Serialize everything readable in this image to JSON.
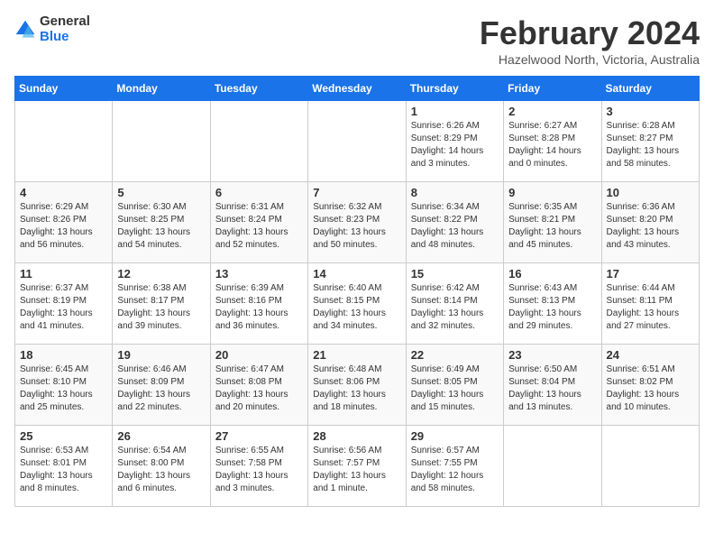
{
  "header": {
    "logo_general": "General",
    "logo_blue": "Blue",
    "month_title": "February 2024",
    "subtitle": "Hazelwood North, Victoria, Australia"
  },
  "days_of_week": [
    "Sunday",
    "Monday",
    "Tuesday",
    "Wednesday",
    "Thursday",
    "Friday",
    "Saturday"
  ],
  "weeks": [
    [
      {
        "day": "",
        "info": ""
      },
      {
        "day": "",
        "info": ""
      },
      {
        "day": "",
        "info": ""
      },
      {
        "day": "",
        "info": ""
      },
      {
        "day": "1",
        "info": "Sunrise: 6:26 AM\nSunset: 8:29 PM\nDaylight: 14 hours\nand 3 minutes."
      },
      {
        "day": "2",
        "info": "Sunrise: 6:27 AM\nSunset: 8:28 PM\nDaylight: 14 hours\nand 0 minutes."
      },
      {
        "day": "3",
        "info": "Sunrise: 6:28 AM\nSunset: 8:27 PM\nDaylight: 13 hours\nand 58 minutes."
      }
    ],
    [
      {
        "day": "4",
        "info": "Sunrise: 6:29 AM\nSunset: 8:26 PM\nDaylight: 13 hours\nand 56 minutes."
      },
      {
        "day": "5",
        "info": "Sunrise: 6:30 AM\nSunset: 8:25 PM\nDaylight: 13 hours\nand 54 minutes."
      },
      {
        "day": "6",
        "info": "Sunrise: 6:31 AM\nSunset: 8:24 PM\nDaylight: 13 hours\nand 52 minutes."
      },
      {
        "day": "7",
        "info": "Sunrise: 6:32 AM\nSunset: 8:23 PM\nDaylight: 13 hours\nand 50 minutes."
      },
      {
        "day": "8",
        "info": "Sunrise: 6:34 AM\nSunset: 8:22 PM\nDaylight: 13 hours\nand 48 minutes."
      },
      {
        "day": "9",
        "info": "Sunrise: 6:35 AM\nSunset: 8:21 PM\nDaylight: 13 hours\nand 45 minutes."
      },
      {
        "day": "10",
        "info": "Sunrise: 6:36 AM\nSunset: 8:20 PM\nDaylight: 13 hours\nand 43 minutes."
      }
    ],
    [
      {
        "day": "11",
        "info": "Sunrise: 6:37 AM\nSunset: 8:19 PM\nDaylight: 13 hours\nand 41 minutes."
      },
      {
        "day": "12",
        "info": "Sunrise: 6:38 AM\nSunset: 8:17 PM\nDaylight: 13 hours\nand 39 minutes."
      },
      {
        "day": "13",
        "info": "Sunrise: 6:39 AM\nSunset: 8:16 PM\nDaylight: 13 hours\nand 36 minutes."
      },
      {
        "day": "14",
        "info": "Sunrise: 6:40 AM\nSunset: 8:15 PM\nDaylight: 13 hours\nand 34 minutes."
      },
      {
        "day": "15",
        "info": "Sunrise: 6:42 AM\nSunset: 8:14 PM\nDaylight: 13 hours\nand 32 minutes."
      },
      {
        "day": "16",
        "info": "Sunrise: 6:43 AM\nSunset: 8:13 PM\nDaylight: 13 hours\nand 29 minutes."
      },
      {
        "day": "17",
        "info": "Sunrise: 6:44 AM\nSunset: 8:11 PM\nDaylight: 13 hours\nand 27 minutes."
      }
    ],
    [
      {
        "day": "18",
        "info": "Sunrise: 6:45 AM\nSunset: 8:10 PM\nDaylight: 13 hours\nand 25 minutes."
      },
      {
        "day": "19",
        "info": "Sunrise: 6:46 AM\nSunset: 8:09 PM\nDaylight: 13 hours\nand 22 minutes."
      },
      {
        "day": "20",
        "info": "Sunrise: 6:47 AM\nSunset: 8:08 PM\nDaylight: 13 hours\nand 20 minutes."
      },
      {
        "day": "21",
        "info": "Sunrise: 6:48 AM\nSunset: 8:06 PM\nDaylight: 13 hours\nand 18 minutes."
      },
      {
        "day": "22",
        "info": "Sunrise: 6:49 AM\nSunset: 8:05 PM\nDaylight: 13 hours\nand 15 minutes."
      },
      {
        "day": "23",
        "info": "Sunrise: 6:50 AM\nSunset: 8:04 PM\nDaylight: 13 hours\nand 13 minutes."
      },
      {
        "day": "24",
        "info": "Sunrise: 6:51 AM\nSunset: 8:02 PM\nDaylight: 13 hours\nand 10 minutes."
      }
    ],
    [
      {
        "day": "25",
        "info": "Sunrise: 6:53 AM\nSunset: 8:01 PM\nDaylight: 13 hours\nand 8 minutes."
      },
      {
        "day": "26",
        "info": "Sunrise: 6:54 AM\nSunset: 8:00 PM\nDaylight: 13 hours\nand 6 minutes."
      },
      {
        "day": "27",
        "info": "Sunrise: 6:55 AM\nSunset: 7:58 PM\nDaylight: 13 hours\nand 3 minutes."
      },
      {
        "day": "28",
        "info": "Sunrise: 6:56 AM\nSunset: 7:57 PM\nDaylight: 13 hours\nand 1 minute."
      },
      {
        "day": "29",
        "info": "Sunrise: 6:57 AM\nSunset: 7:55 PM\nDaylight: 12 hours\nand 58 minutes."
      },
      {
        "day": "",
        "info": ""
      },
      {
        "day": "",
        "info": ""
      }
    ]
  ]
}
